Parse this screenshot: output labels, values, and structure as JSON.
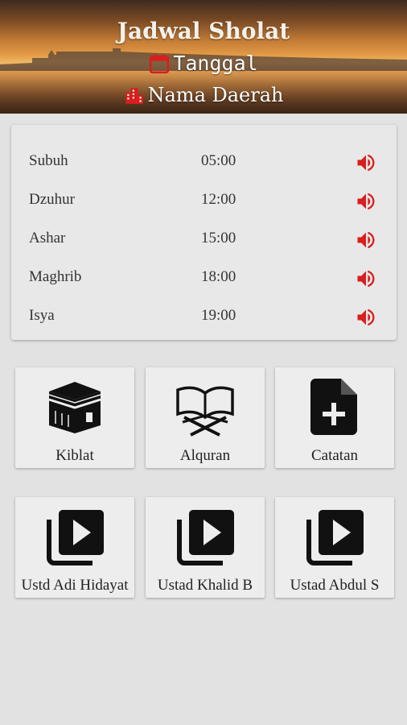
{
  "header": {
    "title": "Jadwal Sholat",
    "date_label": "Tanggal",
    "region_label": "Nama Daerah",
    "icon_color": "#d91e1e"
  },
  "prayers": [
    {
      "name": "Subuh",
      "time": "05:00"
    },
    {
      "name": "Dzuhur",
      "time": "12:00"
    },
    {
      "name": "Ashar",
      "time": "15:00"
    },
    {
      "name": "Maghrib",
      "time": "18:00"
    },
    {
      "name": "Isya",
      "time": "19:00"
    }
  ],
  "menu": [
    {
      "label": "Kiblat",
      "icon": "kaaba-icon"
    },
    {
      "label": "Alquran",
      "icon": "quran-icon"
    },
    {
      "label": "Catatan",
      "icon": "note-add-icon"
    }
  ],
  "videos": [
    {
      "label": "Ustd Adi Hidayat",
      "icon": "video-library-icon"
    },
    {
      "label": "Ustad Khalid B",
      "icon": "video-library-icon"
    },
    {
      "label": "Ustad Abdul S",
      "icon": "video-library-icon"
    }
  ],
  "colors": {
    "accent": "#d91e1e",
    "background": "#e2e2e2",
    "card": "#e8e8e8"
  }
}
